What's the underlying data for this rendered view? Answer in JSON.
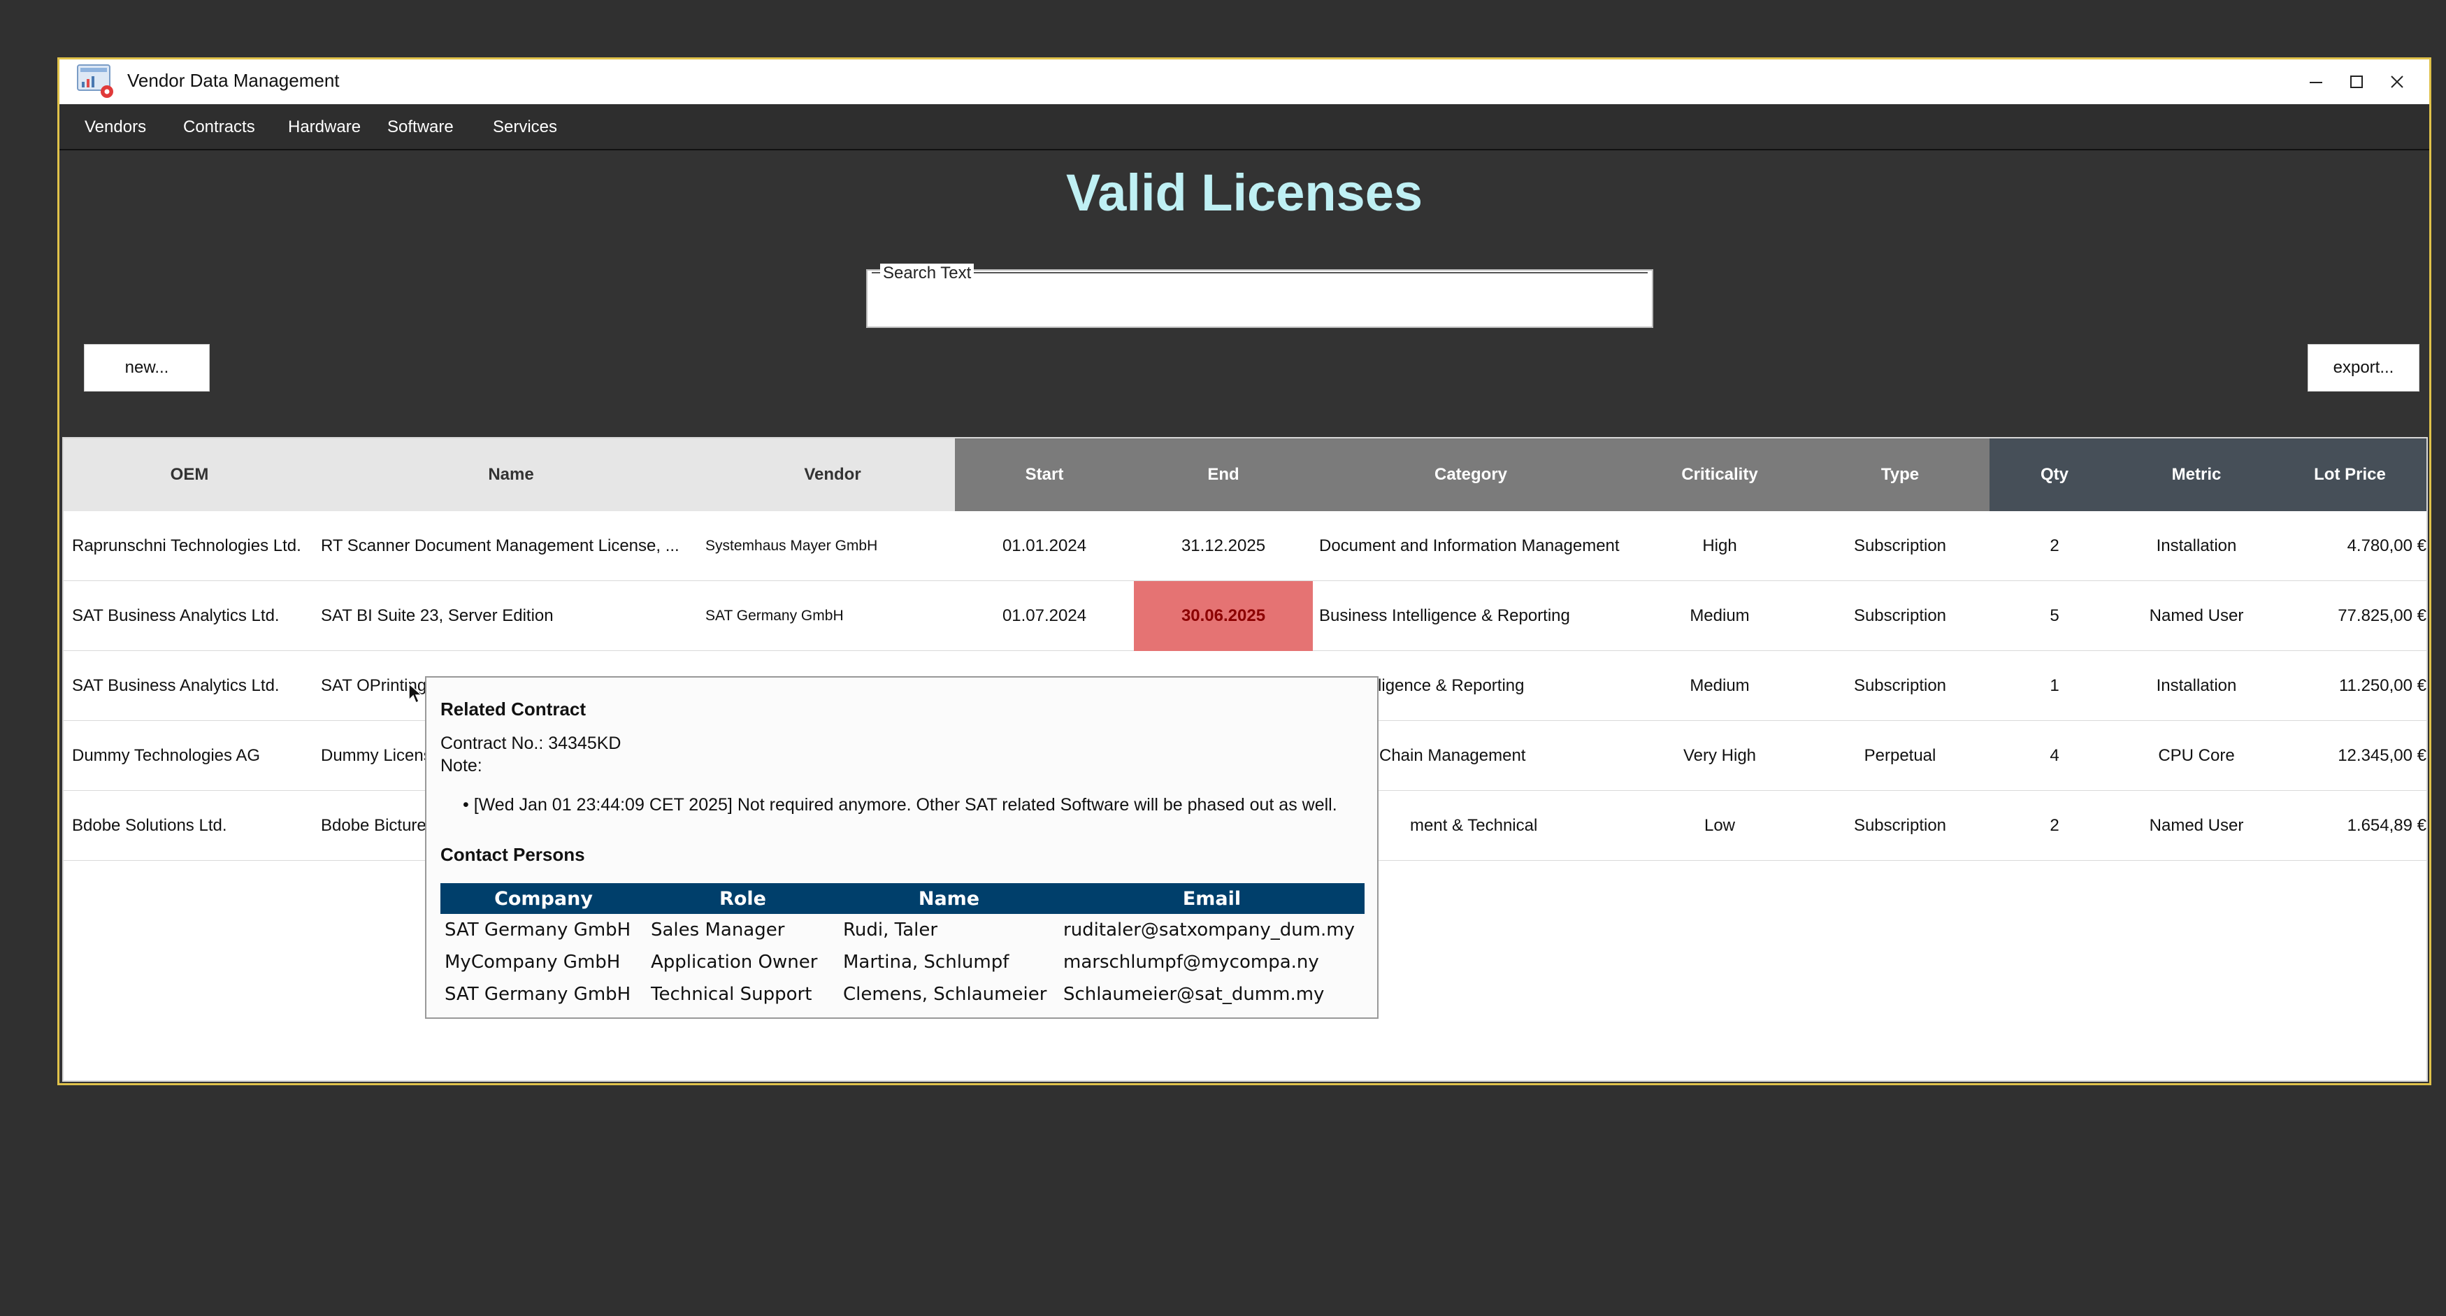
{
  "window": {
    "title": "Vendor Data Management"
  },
  "menu": [
    "Vendors",
    "Contracts",
    "Hardware",
    "Software",
    "Services"
  ],
  "page": {
    "title": "Valid Licenses",
    "search_legend": "Search Text",
    "search_value": "",
    "new_button": "new...",
    "export_button": "export..."
  },
  "table": {
    "headers": [
      "OEM",
      "Name",
      "Vendor",
      "Start",
      "End",
      "Category",
      "Criticality",
      "Type",
      "Qty",
      "Metric",
      "Lot Price"
    ],
    "rows": [
      [
        "Raprunschni Technologies Ltd.",
        "RT Scanner Document Management License, ...",
        "Systemhaus Mayer GmbH",
        "01.01.2024",
        "31.12.2025",
        "Document and Information Management",
        "High",
        "Subscription",
        "2",
        "Installation",
        "4.780,00 €"
      ],
      [
        "SAT Business Analytics Ltd.",
        "SAT BI Suite 23, Server Edition",
        "SAT Germany GmbH",
        "01.07.2024",
        "30.06.2025",
        "Business Intelligence & Reporting",
        "Medium",
        "Subscription",
        "5",
        "Named User",
        "77.825,00 €"
      ],
      [
        "SAT Business Analytics Ltd.",
        "SAT OPrinting",
        "",
        "",
        "",
        "s Intelligence & Reporting",
        "Medium",
        "Subscription",
        "1",
        "Installation",
        "11.250,00 €"
      ],
      [
        "Dummy Technologies AG",
        "Dummy Licens",
        "",
        "",
        "",
        "Chain Management",
        "Very High",
        "Perpetual",
        "4",
        "CPU Core",
        "12.345,00 €"
      ],
      [
        "Bdobe Solutions Ltd.",
        "Bdobe Bicture",
        "",
        "",
        "",
        "ment & Technical",
        "Low",
        "Subscription",
        "2",
        "Named User",
        "1.654,89 €"
      ]
    ]
  },
  "tooltip": {
    "heading": "Related Contract",
    "contract_no": "Contract No.: 34345KD",
    "note_label": "Note:",
    "note": "[Wed Jan 01 23:44:09 CET 2025] Not required anymore. Other SAT related Software will be phased out as well.",
    "contacts_heading": "Contact Persons",
    "contact_headers": [
      "Company",
      "Role",
      "Name",
      "Email"
    ],
    "contacts": [
      [
        "SAT Germany GmbH",
        "Sales Manager",
        "Rudi, Taler",
        "ruditaler@satxompany_dum.my"
      ],
      [
        "MyCompany GmbH",
        "Application Owner",
        "Martina, Schlumpf",
        "marschlumpf@mycompa.ny"
      ],
      [
        "SAT Germany GmbH",
        "Technical Support",
        "Clemens, Schlaumeier",
        "Schlaumeier@sat_dumm.my"
      ]
    ]
  },
  "colors": {
    "title": "#bff0f4",
    "window_border": "#e0c24a",
    "expired_cell": "#e57373",
    "contact_header": "#003f6b"
  }
}
